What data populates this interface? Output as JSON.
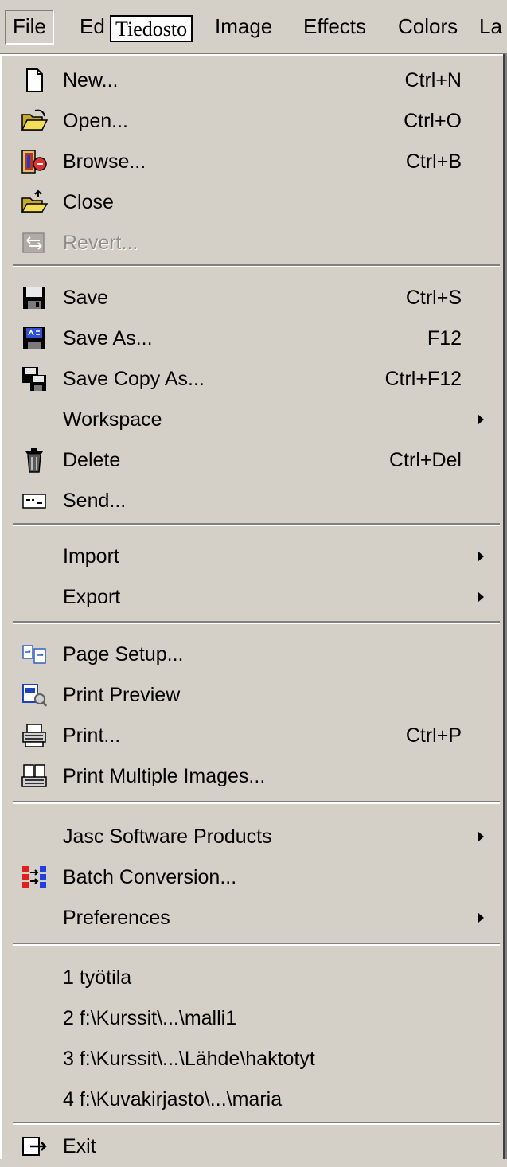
{
  "menubar": {
    "items": [
      {
        "label": "File"
      },
      {
        "label": "Ed"
      },
      {
        "label": "Image"
      },
      {
        "label": "Effects"
      },
      {
        "label": "Colors"
      },
      {
        "label": "La"
      }
    ],
    "tooltip": "Tiedosto"
  },
  "menu": {
    "items": [
      {
        "label": "New...",
        "shortcut": "Ctrl+N",
        "icon": "new-document-icon"
      },
      {
        "label": "Open...",
        "shortcut": "Ctrl+O",
        "icon": "open-folder-icon"
      },
      {
        "label": "Browse...",
        "shortcut": "Ctrl+B",
        "icon": "browse-icon"
      },
      {
        "label": "Close",
        "shortcut": "",
        "icon": "close-folder-icon"
      },
      {
        "label": "Revert...",
        "shortcut": "",
        "icon": "revert-icon",
        "disabled": true
      },
      {
        "label": "Save",
        "shortcut": "Ctrl+S",
        "icon": "save-icon"
      },
      {
        "label": "Save As...",
        "shortcut": "F12",
        "icon": "save-as-icon"
      },
      {
        "label": "Save Copy As...",
        "shortcut": "Ctrl+F12",
        "icon": "save-copy-icon"
      },
      {
        "label": "Workspace",
        "submenu": true
      },
      {
        "label": "Delete",
        "shortcut": "Ctrl+Del",
        "icon": "trash-icon"
      },
      {
        "label": "Send...",
        "shortcut": "",
        "icon": "send-icon"
      },
      {
        "label": "Import",
        "submenu": true
      },
      {
        "label": "Export",
        "submenu": true
      },
      {
        "label": "Page Setup...",
        "shortcut": "",
        "icon": "page-setup-icon"
      },
      {
        "label": "Print Preview",
        "shortcut": "",
        "icon": "print-preview-icon"
      },
      {
        "label": "Print...",
        "shortcut": "Ctrl+P",
        "icon": "printer-icon"
      },
      {
        "label": "Print Multiple Images...",
        "shortcut": "",
        "icon": "print-multiple-icon"
      },
      {
        "label": "Jasc Software Products",
        "submenu": true
      },
      {
        "label": "Batch Conversion...",
        "shortcut": "",
        "icon": "batch-conversion-icon"
      },
      {
        "label": "Preferences",
        "submenu": true
      },
      {
        "label": "1 työtila"
      },
      {
        "label": "2 f:\\Kurssit\\...\\malli1"
      },
      {
        "label": "3 f:\\Kurssit\\...\\Lähde\\haktotyt"
      },
      {
        "label": "4 f:\\Kuvakirjasto\\...\\maria"
      },
      {
        "label": "Exit",
        "shortcut": "",
        "icon": "exit-icon"
      }
    ]
  }
}
